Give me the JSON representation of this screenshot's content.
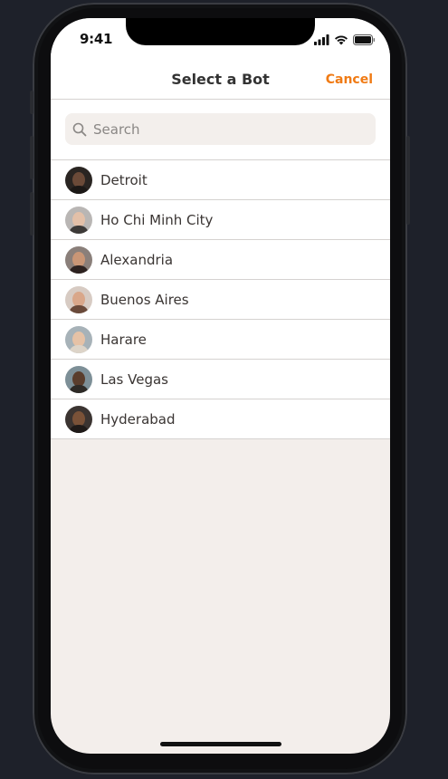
{
  "status_bar": {
    "time": "9:41",
    "icons": [
      "signal-icon",
      "wifi-icon",
      "battery-icon"
    ]
  },
  "header": {
    "title": "Select a Bot",
    "cancel_label": "Cancel"
  },
  "search": {
    "placeholder": "Search",
    "value": ""
  },
  "bots": [
    {
      "name": "Detroit",
      "avatar": {
        "bg": "#2a2522",
        "skin": "#6b4a38",
        "shirt": "#1c1816"
      }
    },
    {
      "name": "Ho Chi Minh City",
      "avatar": {
        "bg": "#b9b6b4",
        "skin": "#e3c0a8",
        "shirt": "#3d3a38"
      }
    },
    {
      "name": "Alexandria",
      "avatar": {
        "bg": "#8a7f7a",
        "skin": "#c99676",
        "shirt": "#2d2220"
      }
    },
    {
      "name": "Buenos Aires",
      "avatar": {
        "bg": "#d7cbc3",
        "skin": "#d9a78a",
        "shirt": "#6a4a3a"
      }
    },
    {
      "name": "Harare",
      "avatar": {
        "bg": "#a7b2b8",
        "skin": "#e6c2a6",
        "shirt": "#ddd4c8"
      }
    },
    {
      "name": "Las Vegas",
      "avatar": {
        "bg": "#7d8f97",
        "skin": "#5a3d2c",
        "shirt": "#2e2a26"
      }
    },
    {
      "name": "Hyderabad",
      "avatar": {
        "bg": "#3b3431",
        "skin": "#7a5238",
        "shirt": "#1f1a18"
      }
    }
  ],
  "colors": {
    "accent": "#f07b15",
    "background": "#f3eeeb",
    "divider": "#d5d2d0"
  }
}
